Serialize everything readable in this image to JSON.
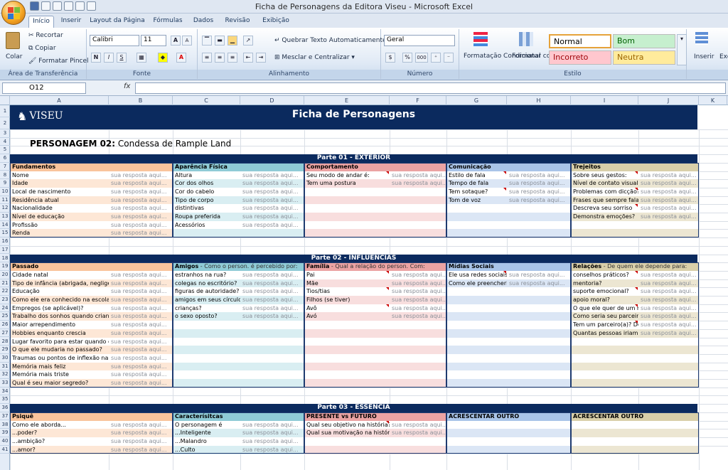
{
  "window": {
    "title": "Ficha de Personagens da Editora Viseu - Microsoft Excel"
  },
  "ribbon_tabs": [
    "Início",
    "Inserir",
    "Layout da Página",
    "Fórmulas",
    "Dados",
    "Revisão",
    "Exibição"
  ],
  "ribbon": {
    "clipboard": {
      "paste": "Colar",
      "cut": "Recortar",
      "copy": "Copiar",
      "format_painter": "Formatar Pincel",
      "label": "Área de Transferência"
    },
    "font": {
      "name": "Calibri",
      "size": "11",
      "label": "Fonte",
      "bold": "N",
      "italic": "I",
      "underline": "S",
      "grow": "A",
      "shrink": "A"
    },
    "alignment": {
      "wrap": "Quebrar Texto Automaticamente",
      "merge": "Mesclar e Centralizar",
      "label": "Alinhamento"
    },
    "number": {
      "format": "Geral",
      "label": "Número",
      "percent": "%",
      "thousands": "000"
    },
    "styles": {
      "cond": "Formatação Condicional",
      "table": "Formatar como Tabela",
      "normal": "Normal",
      "bom": "Bom",
      "incorreto": "Incorreto",
      "neutra": "Neutra",
      "label": "Estilo"
    },
    "cells": {
      "insert": "Inserir",
      "excl": "Exc"
    }
  },
  "formula_bar": {
    "name_box": "O12",
    "fx": "fx",
    "content": ""
  },
  "columns": [
    "A",
    "B",
    "C",
    "D",
    "E",
    "F",
    "G",
    "H",
    "I",
    "J",
    "K"
  ],
  "sheet": {
    "logo": "VISEU",
    "title": "Ficha de Personagens",
    "character_label": "PERSONAGEM 02:",
    "character_name": "Condessa de Rample Land",
    "answer": "sua resposta aqui...",
    "part1": {
      "title": "Parte 01 - EXTERIOR",
      "cols": [
        {
          "header": "Fundamentos",
          "items": [
            "Nome",
            "Idade",
            "Local de nascimento",
            "Residência atual",
            "Nacionalidade",
            "Nível de educação",
            "Profissão",
            "Renda"
          ]
        },
        {
          "header": "Aparência Física",
          "items": [
            "Altura",
            "Cor dos olhos",
            "Cor do cabelo",
            "Tipo de corpo",
            "distintivas",
            "Roupa preferida",
            "Acessórios"
          ]
        },
        {
          "header": "Comportamento",
          "items": [
            "Seu modo de andar é:",
            "Tem uma postura"
          ]
        },
        {
          "header": "Comunicação",
          "items": [
            "Estilo de fala",
            "Tempo de fala",
            "Tem sotaque?",
            "Tom de voz"
          ]
        },
        {
          "header": "Trejeitos",
          "items": [
            "Sobre seus gestos:",
            "Nível de contato visual",
            "Problemas com dicção?",
            "Frases que sempre fala",
            "Descreva seu sorriso",
            "Demonstra emoções?"
          ]
        }
      ]
    },
    "part2": {
      "title": "Parte 02 - INFLUÊNCIAS",
      "cols": [
        {
          "header": "Passado",
          "sub": "",
          "items": [
            "Cidade natal",
            "Tipo de infância (abrigada, negligenciada",
            "Educação",
            "Como ele era conhecido na escola?",
            "Empregos (se aplicável)?",
            "Trabalho dos sonhos quando criança?",
            "Maior arrependimento",
            "Hobbies enquanto crescia",
            "Lugar favorito para estar quando criança",
            "O que ele mudaria no passado?",
            "Traumas ou pontos de inflexão na infância",
            "Memória mais feliz",
            "Memória mais triste",
            "Qual é seu maior segredo?"
          ]
        },
        {
          "header": "Amigos",
          "sub": "- Como o person. é percebido por:",
          "items": [
            "estranhos na rua?",
            "colegas no escritório?",
            "figuras de autoridade?",
            "amigos em seus círculos",
            "crianças?",
            "o sexo oposto?"
          ]
        },
        {
          "header": "Família",
          "sub": "- Qual a relação do person. Com:",
          "items": [
            "Pai",
            "Mãe",
            "Tios/tias",
            "Filhos (se tiver)",
            "Avô",
            "Avó"
          ]
        },
        {
          "header": "Mídias Sociais",
          "sub": "",
          "items": [
            "Ele usa redes sociais?",
            "Como ele preencheria o perfil"
          ]
        },
        {
          "header": "Relações",
          "sub": "- De quem ele depende para:",
          "items": [
            "conselhos práticos?",
            "mentoria?",
            "suporte emocional?",
            "apoio moral?",
            "O que ele quer de um relacionamento",
            "Como seria seu parceiro ideal?",
            "Tem um parceiro(a)? Descreva",
            "Quantas pessoas iriam ao seu funeral"
          ]
        }
      ]
    },
    "part3": {
      "title": "Parte 03 - ESSÊNCIA",
      "cols": [
        {
          "header": "Psiquê",
          "items": [
            "Como ele aborda...",
            "...poder?",
            "...ambição?",
            "...amor?"
          ]
        },
        {
          "header": "Caracterísitcas",
          "items": [
            "O personagem é",
            "...Inteligente",
            "...Malandro",
            "...Culto"
          ]
        },
        {
          "header": "PRESENTE  vs FUTURO",
          "items": [
            "Qual seu objetivo na história?",
            "Qual sua motivação na história?"
          ]
        },
        {
          "header": "ACRESCENTAR OUTRO",
          "items": []
        },
        {
          "header": "ACRESCENTAR OUTRO",
          "items": []
        }
      ]
    }
  },
  "colors": {
    "navy": "#0b2a5e",
    "orange": "#f9c49c",
    "orange_light": "#fde7d6",
    "teal": "#8fcbd6",
    "teal_light": "#d9eef2",
    "pink": "#eba3a3",
    "pink_light": "#f8dede",
    "blue": "#a9c4e8",
    "blue_light": "#dbe6f5",
    "tan": "#d9cfa9",
    "tan_light": "#ece6d2"
  }
}
